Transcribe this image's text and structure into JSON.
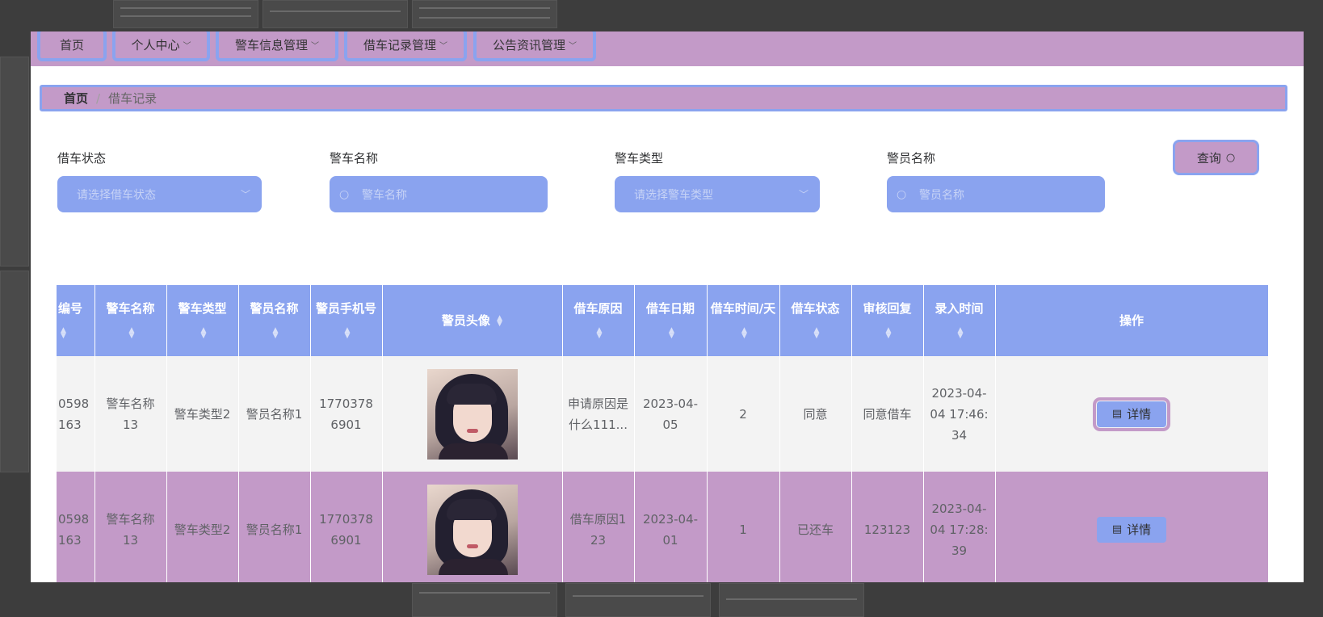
{
  "nav": {
    "items": [
      {
        "label": "首页",
        "has_dropdown": false
      },
      {
        "label": "个人中心",
        "has_dropdown": true
      },
      {
        "label": "警车信息管理",
        "has_dropdown": true
      },
      {
        "label": "借车记录管理",
        "has_dropdown": true
      },
      {
        "label": "公告资讯管理",
        "has_dropdown": true
      }
    ]
  },
  "breadcrumb": {
    "home": "首页",
    "separator": "/",
    "current": "借车记录"
  },
  "filters": {
    "status": {
      "label": "借车状态",
      "placeholder": "请选择借车状态"
    },
    "car_name": {
      "label": "警车名称",
      "placeholder": "警车名称"
    },
    "car_type": {
      "label": "警车类型",
      "placeholder": "请选择警车类型"
    },
    "officer_name": {
      "label": "警员名称",
      "placeholder": "警员名称"
    },
    "query_label": "查询"
  },
  "table": {
    "columns": [
      "编号",
      "警车名称",
      "警车类型",
      "警员名称",
      "警员手机号",
      "警员头像",
      "借车原因",
      "借车日期",
      "借车时间/天",
      "借车状态",
      "审核回复",
      "录入时间",
      "操作"
    ],
    "rows": [
      {
        "id": "0598163",
        "car_name": "警车名称13",
        "car_type": "警车类型2",
        "officer_name": "警员名称1",
        "phone": "17703786901",
        "reason": "申请原因是什么111...",
        "date": "2023-04-05",
        "days": "2",
        "status": "同意",
        "reply": "同意借车",
        "created": "2023-04-04 17:46:34",
        "action": "详情"
      },
      {
        "id": "0598163",
        "car_name": "警车名称13",
        "car_type": "警车类型2",
        "officer_name": "警员名称1",
        "phone": "17703786901",
        "reason": "借车原因123",
        "date": "2023-04-01",
        "days": "1",
        "status": "已还车",
        "reply": "123123",
        "created": "2023-04-04 17:28:39",
        "action": "详情"
      }
    ]
  },
  "colors": {
    "accent": "#8aa3ef",
    "highlight": "#c39ac8",
    "overlay_bg": "#3d3d3d"
  }
}
